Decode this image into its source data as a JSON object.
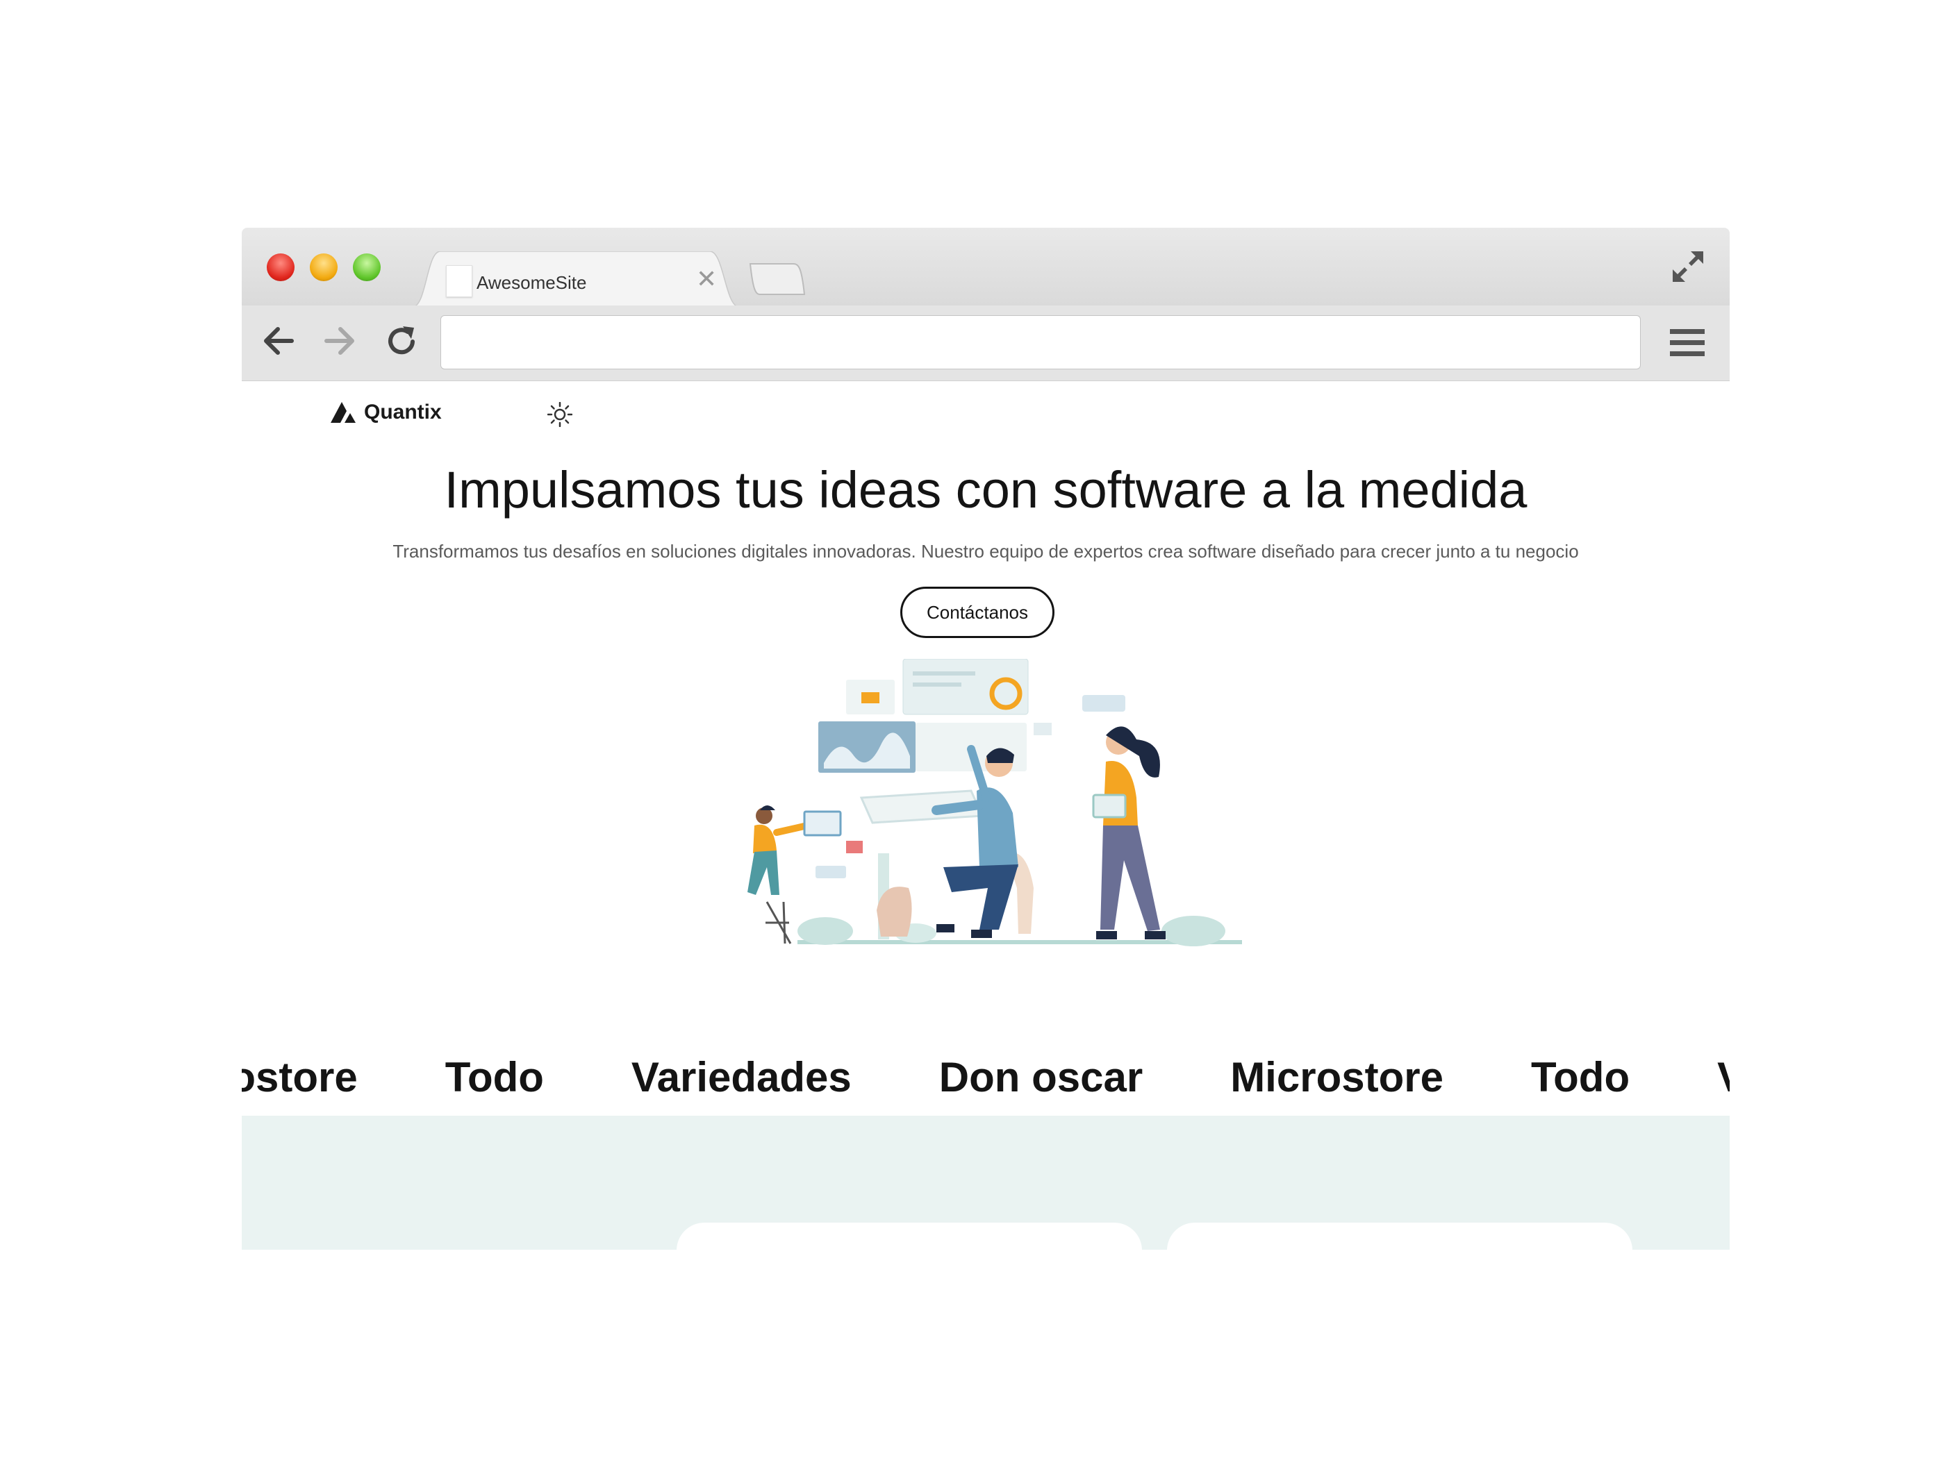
{
  "browser": {
    "tab_title": "AwesomeSite",
    "tab_close": "✕",
    "address_value": ""
  },
  "site": {
    "logo_text": "Quantix",
    "hero_title": "Impulsamos tus ideas con software a la medida",
    "hero_subtitle": "Transformamos tus desafíos en soluciones digitales innovadoras. Nuestro equipo de expertos crea software diseñado para crecer junto a tu negocio",
    "cta_label": "Contáctanos",
    "brands": [
      "Microstore",
      "Todo",
      "Variedades",
      "Don oscar",
      "Microstore",
      "Todo",
      "Variedades"
    ]
  },
  "colors": {
    "accent": "#f4a522",
    "teal": "#9bc9c4",
    "section_bg": "#eaf3f2",
    "dark_text": "#141414"
  },
  "icons": {
    "logo": "logo-triangle-icon",
    "theme": "sun-icon",
    "back": "arrow-left-icon",
    "forward": "arrow-right-icon",
    "reload": "reload-icon",
    "menu": "hamburger-menu-icon",
    "fullscreen": "expand-icon"
  }
}
